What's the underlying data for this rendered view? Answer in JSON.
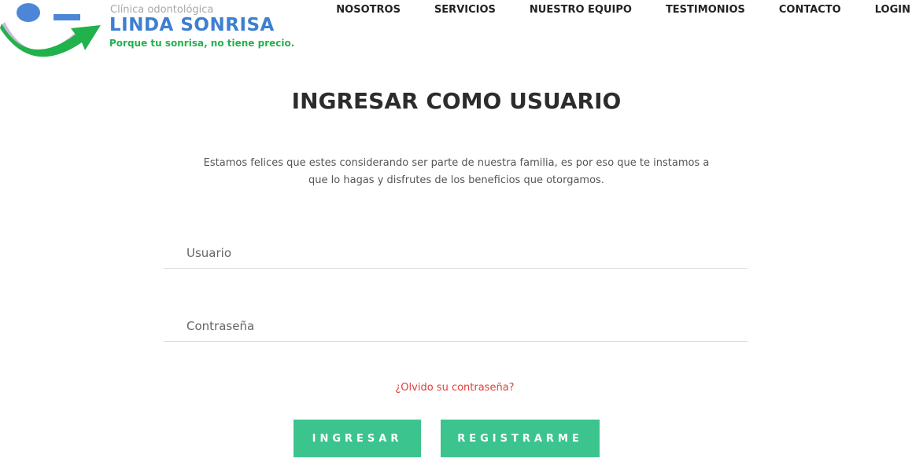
{
  "logo": {
    "subtitle": "Clínica odontológica",
    "brand": "LINDA SONRISA",
    "tagline": "Porque tu sonrisa, no tiene precio."
  },
  "nav": {
    "items": [
      "NOSOTROS",
      "SERVICIOS",
      "NUESTRO EQUIPO",
      "TESTIMONIOS",
      "CONTACTO",
      "LOGIN"
    ]
  },
  "login": {
    "title": "INGRESAR COMO USUARIO",
    "intro": "Estamos felices que estes considerando ser parte de nuestra familia, es por eso que te instamos a que lo hagas y disfrutes de los beneficios que otorgamos.",
    "username_placeholder": "Usuario",
    "password_placeholder": "Contraseña",
    "forgot_label": "¿Olvido su contraseña?",
    "submit_label": "INGRESAR",
    "register_label": "REGISTRARME"
  },
  "colors": {
    "accent_green": "#3cc48f",
    "brand_blue": "#3d7fd1",
    "tagline_green": "#22b24c",
    "link_red": "#e0403a"
  }
}
